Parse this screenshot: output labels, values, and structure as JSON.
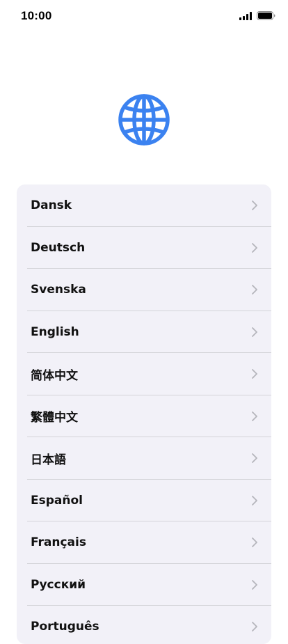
{
  "status_bar": {
    "time": "10:00"
  },
  "header": {
    "icon": "globe-icon",
    "accent_color": "#3b82f0"
  },
  "languages": [
    {
      "label": "Dansk"
    },
    {
      "label": "Deutsch"
    },
    {
      "label": "Svenska"
    },
    {
      "label": "English"
    },
    {
      "label": "简体中文"
    },
    {
      "label": "繁體中文"
    },
    {
      "label": "日本語"
    },
    {
      "label": "Español"
    },
    {
      "label": "Français"
    },
    {
      "label": "Русский"
    },
    {
      "label": "Português"
    }
  ]
}
